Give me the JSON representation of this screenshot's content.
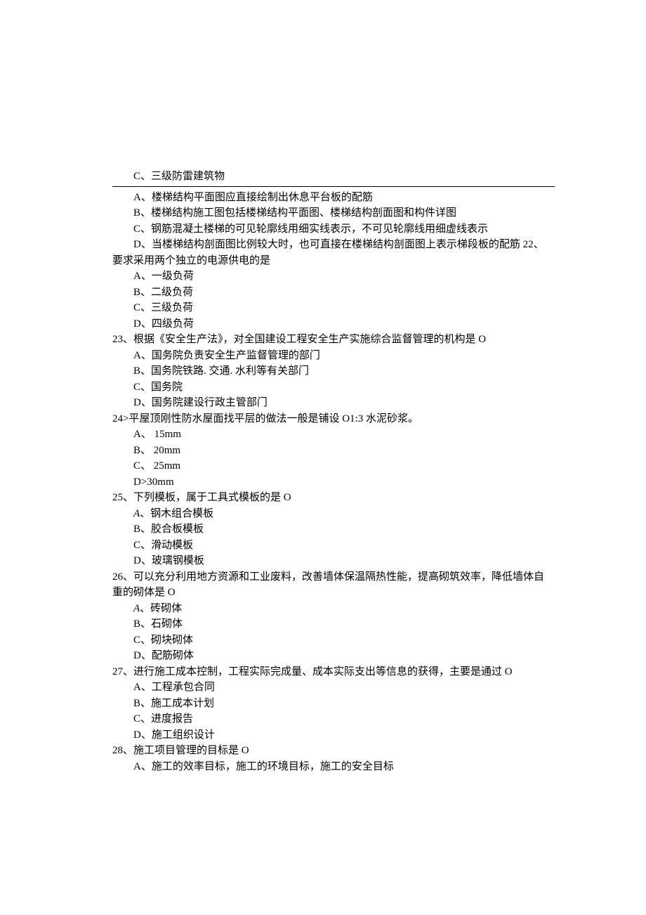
{
  "lines": [
    {
      "cls": "indent1",
      "text": "C、三级防雷建筑物"
    },
    {
      "hr": true
    },
    {
      "cls": "indent1",
      "text": "A、楼梯结构平面图应直接绘制出休息平台板的配筋"
    },
    {
      "cls": "indent1",
      "text": "B、楼梯结构施工图包括楼梯结构平面图、楼梯结构剖面图和构件详图"
    },
    {
      "cls": "indent1",
      "text": "C、钢筋混凝土楼梯的可见轮廓线用细实线表示，不可见轮廓线用细虚线表示"
    },
    {
      "cls": "indent1",
      "text": "D、当楼梯结构剖面图比例较大时，也可直接在楼梯结构剖面图上表示梯段板的配筋 22、"
    },
    {
      "cls": "",
      "text": "要求采用两个独立的电源供电的是"
    },
    {
      "cls": "indent2",
      "text": "A、一级负荷"
    },
    {
      "cls": "indent2",
      "text": "B、二级负荷"
    },
    {
      "cls": "indent2",
      "text": "C、三级负荷"
    },
    {
      "cls": "indent2",
      "text": "D、四级负荷"
    },
    {
      "cls": "",
      "text": "23、根据《安全生产法》，对全国建设工程安全生产实施综合监督管理的机构是 O"
    },
    {
      "cls": "indent2",
      "text": "A、国务院负责安全生产监督管理的部门"
    },
    {
      "cls": "indent2",
      "text": "B、国务院铁路. 交通. 水利等有关部门"
    },
    {
      "cls": "indent2",
      "text": "C、国务院"
    },
    {
      "cls": "indent2",
      "text": "D、国务院建设行政主管部门"
    },
    {
      "cls": "",
      "text": "24>平屋顶刚性防水屋面找平层的做法一般是铺设 O1:3 水泥砂浆。"
    },
    {
      "cls": "indent2",
      "text": "A、 15mm"
    },
    {
      "cls": "indent2",
      "text": "B、 20mm"
    },
    {
      "cls": "indent2",
      "text": "C、 25mm"
    },
    {
      "cls": "indent2",
      "text": "D>30mm"
    },
    {
      "cls": "",
      "text": "25、下列模板，属于工具式模板的是 O"
    },
    {
      "cls": "indent2",
      "prefix_italic": "A",
      "text": "、钢木组合模板"
    },
    {
      "cls": "indent2",
      "text": "B、胶合板模板"
    },
    {
      "cls": "indent2",
      "text": "C、滑动模板"
    },
    {
      "cls": "indent2",
      "text": "D、玻璃钢模板"
    },
    {
      "cls": "",
      "text": "26、可以充分利用地方资源和工业废料，改善墙体保温隔热性能，提高砌筑效率，降低墙体自"
    },
    {
      "cls": "",
      "text": "重的砌体是 O"
    },
    {
      "cls": "indent2",
      "prefix_italic": "A",
      "text": "、砖砌体"
    },
    {
      "cls": "indent2",
      "text": "B、石砌体"
    },
    {
      "cls": "indent2",
      "text": "C、砌块砌体"
    },
    {
      "cls": "indent2",
      "text": "D、配筋砌体"
    },
    {
      "cls": "",
      "text": "27、进行施工成本控制，工程实际完成量、成本实际支出等信息的获得，主要是通过 O"
    },
    {
      "cls": "indent2",
      "text": "A、工程承包合同"
    },
    {
      "cls": "indent2",
      "text": "B、施工成本计划"
    },
    {
      "cls": "indent2",
      "text": "C、进度报告"
    },
    {
      "cls": "indent2",
      "text": "D、施工组织设计"
    },
    {
      "cls": "",
      "text": "28、施工项目管理的目标是 O"
    },
    {
      "cls": "indent2",
      "text": "A、施工的效率目标，施工的环境目标，施工的安全目标"
    }
  ]
}
